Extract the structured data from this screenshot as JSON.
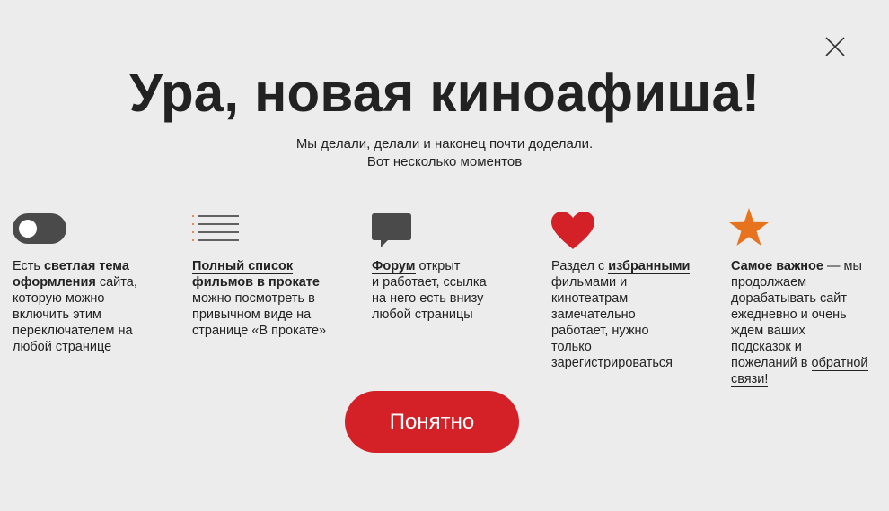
{
  "header": {
    "title": "Ура, новая киноафиша!",
    "subtitle_line1": "Мы делали, делали и наконец почти доделали.",
    "subtitle_line2": "Вот несколько моментов"
  },
  "icons": {
    "close": "close-icon",
    "theme": "toggle-switch-icon",
    "list": "list-icon",
    "forum": "speech-bubble-icon",
    "favorites": "heart-icon",
    "important": "star-icon"
  },
  "colors": {
    "accent": "#d42027",
    "star": "#e8731f",
    "toggle": "#4a4a4a",
    "text": "#222222",
    "background": "#ececec"
  },
  "features": {
    "theme": {
      "t1": "Есть ",
      "b1": "светлая тема",
      "b2": "оформления",
      "t2": " сайта,",
      "t3": "которую можно",
      "t4": "включить этим",
      "t5": "переключателем на",
      "t6": "любой странице"
    },
    "list": {
      "l1": "Полный список",
      "l2": "фильмов в прокате",
      "t1": "можно посмотреть в",
      "t2": "привычном виде на",
      "t3": "странице «В прокате»"
    },
    "forum": {
      "l1": "Форум",
      "t1": " открыт",
      "t2": "и работает, ссылка",
      "t3": "на него есть внизу",
      "t4": "любой страницы"
    },
    "favorites": {
      "t1": "Раздел с ",
      "l1": "избранными",
      "t2": "фильмами и",
      "t3": "кинотеатрам",
      "t4": "замечательно",
      "t5": "работает, нужно",
      "t6": "только",
      "t7": "зарегистрироваться"
    },
    "important": {
      "b1": "Самое важное",
      "t1": " — мы",
      "t2": "продолжаем",
      "t3": "дорабатывать сайт",
      "t4": "ежедневно и очень",
      "t5": "ждем ваших",
      "t6": "подсказок и",
      "t7": "пожеланий в ",
      "l1": "обратной",
      "l2": "связи!"
    }
  },
  "ok_button": "Понятно"
}
